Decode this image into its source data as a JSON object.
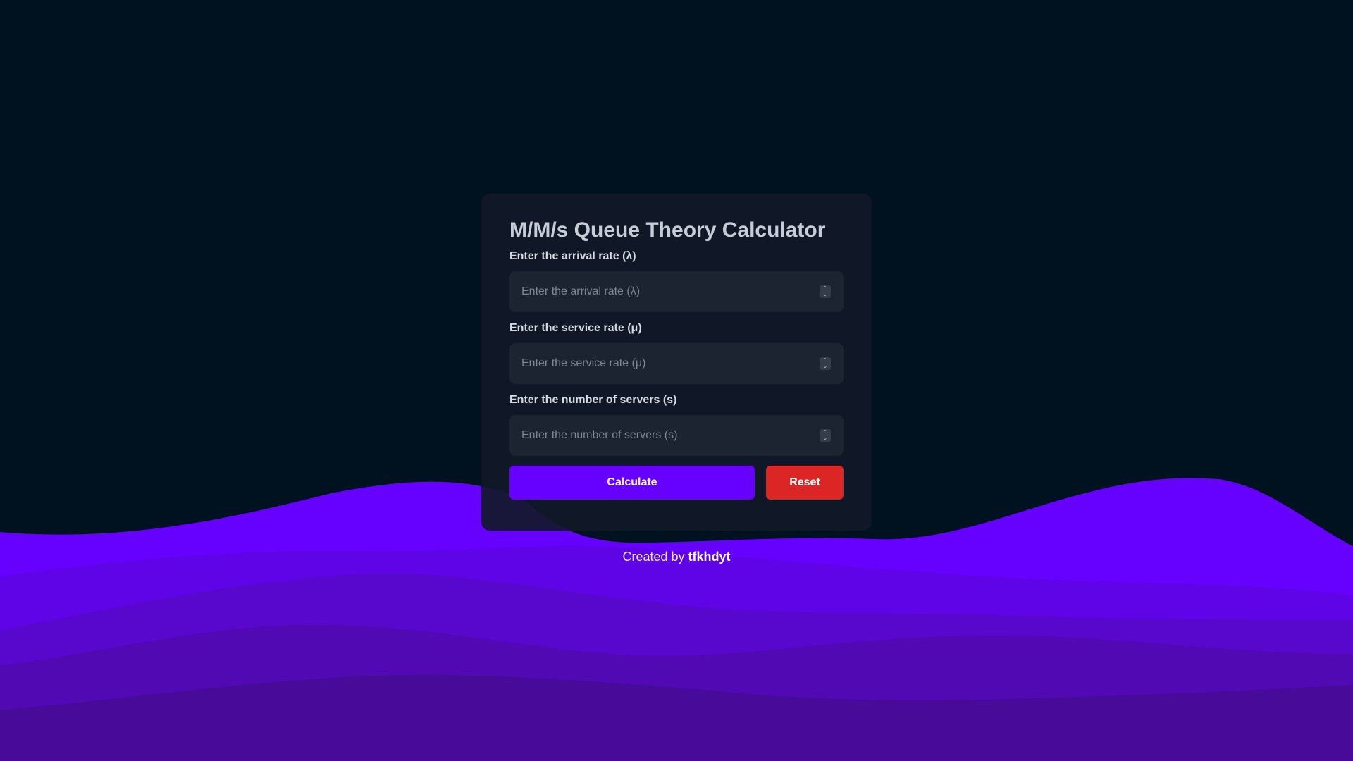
{
  "title": "M/M/s Queue Theory Calculator",
  "fields": [
    {
      "label": "Enter the arrival rate (λ)",
      "placeholder": "Enter the arrival rate (λ)",
      "value": ""
    },
    {
      "label": "Enter the service rate (μ)",
      "placeholder": "Enter the service rate (μ)",
      "value": ""
    },
    {
      "label": "Enter the number of servers (s)",
      "placeholder": "Enter the number of servers (s)",
      "value": ""
    }
  ],
  "buttons": {
    "calculate_label": "Calculate",
    "reset_label": "Reset"
  },
  "footer": {
    "prefix": "Created by",
    "author": "tfkhdyt"
  },
  "colors": {
    "background": "#001220",
    "card": "#111928",
    "accent": "#6600ff",
    "danger": "#dc2626",
    "wave_layers": [
      "#6600ff",
      "#5f04e6",
      "#5807cc",
      "#5009b3",
      "#480a99"
    ]
  }
}
